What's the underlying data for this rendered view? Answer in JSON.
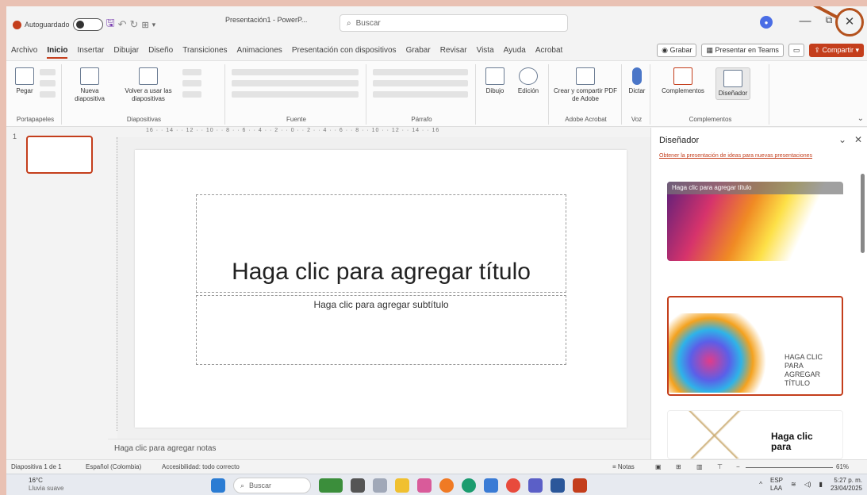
{
  "titlebar": {
    "autosave_label": "Autoguardado",
    "doc_title": "Presentación1 - PowerP...",
    "search_placeholder": "Buscar",
    "minimize": "—",
    "restore": "⧉",
    "close": "✕"
  },
  "menu": {
    "tabs": [
      "Archivo",
      "Inicio",
      "Insertar",
      "Dibujar",
      "Diseño",
      "Transiciones",
      "Animaciones",
      "Presentación con dispositivos",
      "Grabar",
      "Revisar",
      "Vista",
      "Ayuda",
      "Acrobat"
    ],
    "grabar_btn": "Grabar",
    "teams_btn": "Presentar en Teams",
    "share_btn": "Compartir"
  },
  "ribbon": {
    "paste": "Pegar",
    "new_slide": "Nueva diapositiva",
    "reuse": "Volver a usar las diapositivas",
    "dibujo": "Dibujo",
    "edicion": "Edición",
    "pdf": "Crear y compartir PDF de Adobe",
    "dictar": "Dictar",
    "complementos": "Complementos",
    "disenador": "Diseñador",
    "groups": {
      "portapapeles": "Portapapeles",
      "diapositivas": "Diapositivas",
      "fuente": "Fuente",
      "parrafo": "Párrafo",
      "acrobat": "Adobe Acrobat",
      "voz": "Voz",
      "complementos": "Complementos"
    }
  },
  "ruler": "16 · · 14 · · 12 · · 10 · · 8 · · 6 · · 4 · · 2 · · 0 · · 2 · · 4 · · 6 · · 8 · · 10 · · 12 · · 14 · · 16",
  "thumbs": {
    "slide_number": "1"
  },
  "slide": {
    "title_placeholder": "Haga clic para agregar título",
    "subtitle_placeholder": "Haga clic para agregar subtítulo"
  },
  "notes_placeholder": "Haga clic para agregar notas",
  "designer": {
    "title": "Diseñador",
    "link": "Obtener la presentación de ideas para nuevas presentaciones",
    "design1_caption": "Haga clic para agregar título",
    "design2_text": "HAGA CLIC PARA AGREGAR TÍTULO",
    "design3_text": "Haga clic para"
  },
  "status": {
    "slide_info": "Diapositiva 1 de 1",
    "language": "Español (Colombia)",
    "accessibility": "Accesibilidad: todo correcto",
    "notes": "Notas",
    "zoom": "61%"
  },
  "taskbar": {
    "temp": "16°C",
    "weather": "Lluvia suave",
    "search": "Buscar",
    "lang1": "ESP",
    "lang2": "LAA",
    "time": "5:27 p. m.",
    "date": "23/04/2025"
  },
  "colors": {
    "accent": "#c43e1c",
    "annotation": "#b4521e"
  }
}
